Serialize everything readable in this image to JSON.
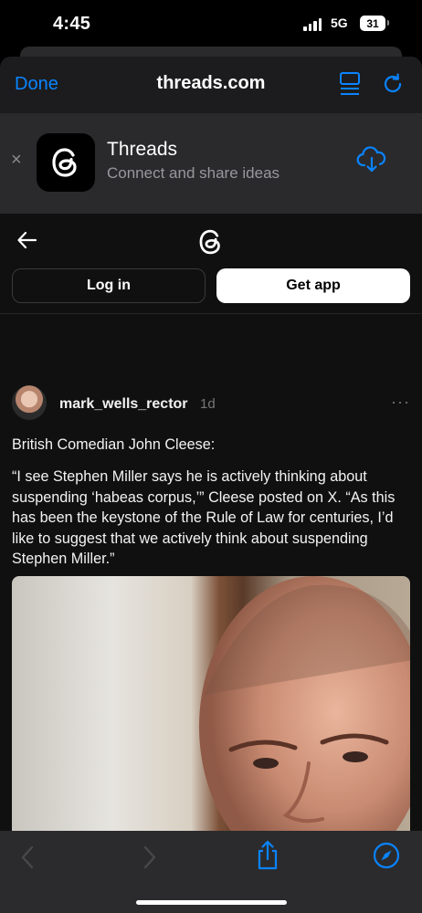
{
  "status_bar": {
    "time": "4:45",
    "network": "5G",
    "battery": "31"
  },
  "safari": {
    "done_label": "Done",
    "domain": "threads.com",
    "icons": {
      "reader": "reader-icon",
      "reload": "reload-icon"
    }
  },
  "app_banner": {
    "close": "×",
    "app_name": "Threads",
    "subtitle": "Connect and share ideas",
    "icons": {
      "app": "threads-logo-icon",
      "download": "cloud-download-icon"
    }
  },
  "threads_page": {
    "login_label": "Log in",
    "get_app_label": "Get app",
    "post": {
      "username": "mark_wells_rector",
      "timestamp": "1d",
      "more": "···",
      "paragraph1": "British Comedian John Cleese:",
      "paragraph2": "“I see Stephen Miller says he is actively thinking about suspending ‘habeas corpus,’” Cleese posted on X. “As this has been the keystone of the Rule of Law for centuries, I’d like to suggest that we actively think about suspending Stephen Miller.”"
    }
  },
  "toolbar": {
    "icons": [
      "chevron-left-icon",
      "chevron-right-icon",
      "share-icon",
      "compass-icon"
    ]
  },
  "colors": {
    "accent": "#0a84ff",
    "sheet_bg": "#1c1c1e",
    "page_bg": "#101010",
    "banner_bg": "#2a2a2c"
  }
}
